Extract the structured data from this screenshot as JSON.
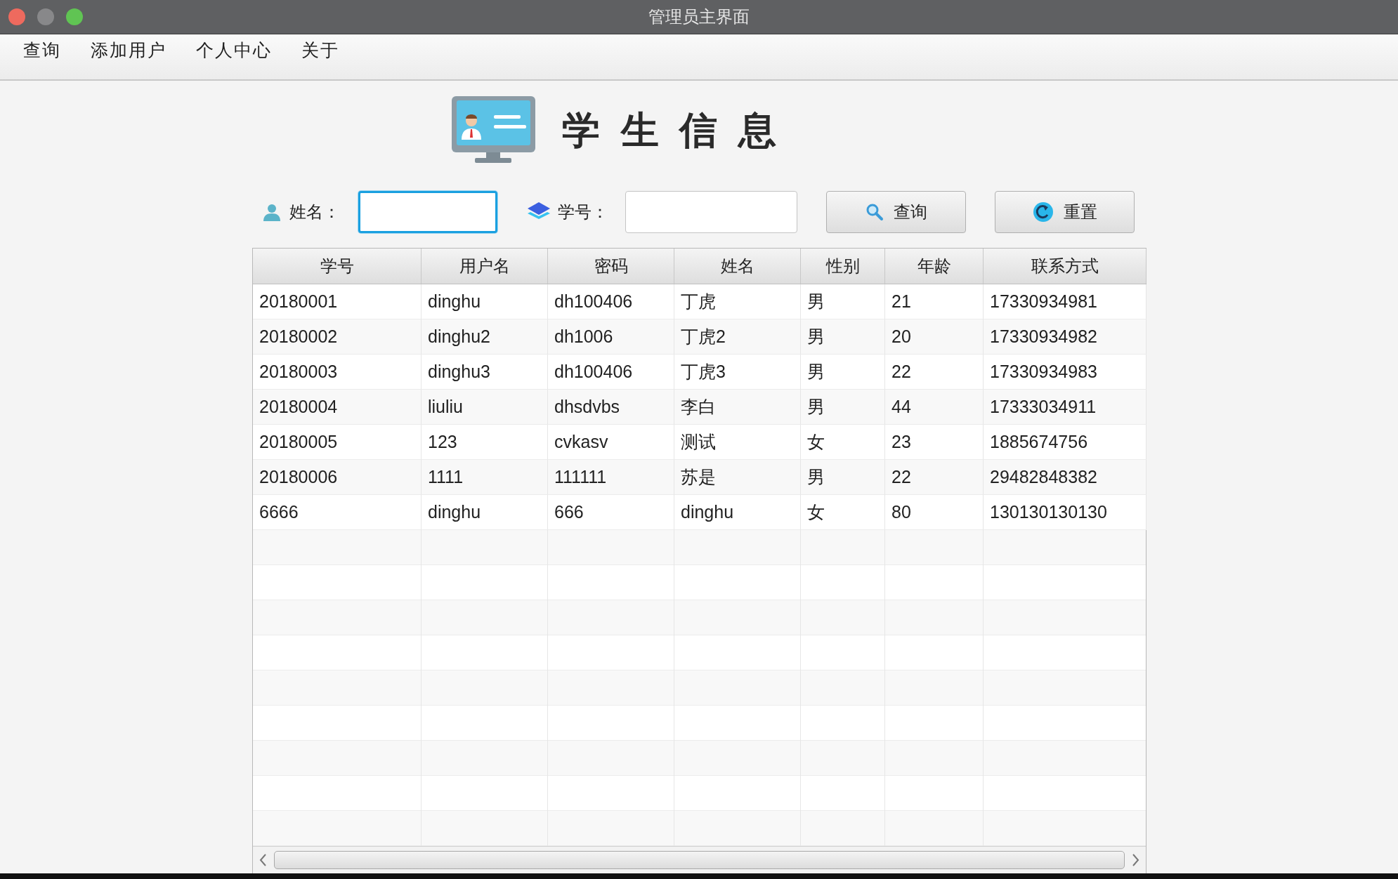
{
  "window": {
    "title": "管理员主界面"
  },
  "menu": [
    {
      "label": "查询"
    },
    {
      "label": "添加用户"
    },
    {
      "label": "个人中心"
    },
    {
      "label": "关于"
    }
  ],
  "header": {
    "title": "学生信息"
  },
  "search": {
    "fields": [
      {
        "kind": "name",
        "label": "姓名：",
        "focused": true
      },
      {
        "kind": "id",
        "label": "学号：",
        "focused": false
      }
    ],
    "buttons": [
      {
        "kind": "search",
        "label": "查询"
      },
      {
        "kind": "reset",
        "label": "重置"
      }
    ]
  },
  "table": {
    "columns": [
      "学号",
      "用户名",
      "密码",
      "姓名",
      "性别",
      "年龄",
      "联系方式"
    ],
    "rows": [
      [
        "20180001",
        "dinghu",
        "dh100406",
        "丁虎",
        "男",
        "21",
        "17330934981"
      ],
      [
        "20180002",
        "dinghu2",
        "dh1006",
        "丁虎2",
        "男",
        "20",
        "17330934982"
      ],
      [
        "20180003",
        "dinghu3",
        "dh100406",
        "丁虎3",
        "男",
        "22",
        "17330934983"
      ],
      [
        "20180004",
        "liuliu",
        "dhsdvbs",
        "李白",
        "男",
        "44",
        "17333034911"
      ],
      [
        "20180005",
        "123",
        "cvkasv",
        "测试",
        "女",
        "23",
        "1885674756"
      ],
      [
        "20180006",
        "1111",
        "111111",
        "苏是",
        "男",
        "22",
        "29482848382"
      ],
      [
        "6666",
        "dinghu",
        "666",
        "dinghu",
        "女",
        "80",
        "130130130130"
      ]
    ]
  }
}
